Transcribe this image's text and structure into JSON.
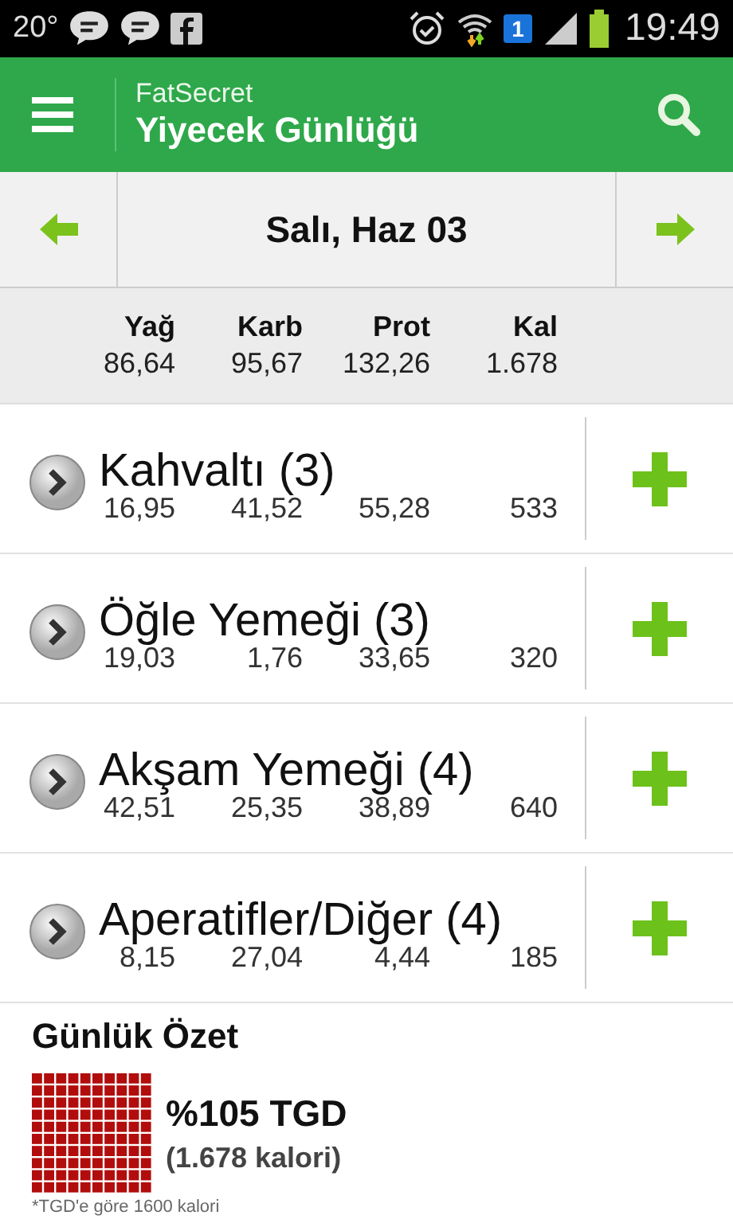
{
  "status_bar": {
    "temperature": "20°",
    "sim_badge": "1",
    "time": "19:49"
  },
  "app_bar": {
    "app_name": "FatSecret",
    "title": "Yiyecek Günlüğü"
  },
  "date_nav": {
    "date": "Salı, Haz 03"
  },
  "totals": {
    "columns": [
      "Yağ",
      "Karb",
      "Prot",
      "Kal"
    ],
    "values": [
      "86,64",
      "95,67",
      "132,26",
      "1.678"
    ]
  },
  "meals": [
    {
      "name": "Kahvaltı (3)",
      "values": [
        "16,95",
        "41,52",
        "55,28",
        "533"
      ]
    },
    {
      "name": "Öğle Yemeği (3)",
      "values": [
        "19,03",
        "1,76",
        "33,65",
        "320"
      ]
    },
    {
      "name": "Akşam Yemeği (4)",
      "values": [
        "42,51",
        "25,35",
        "38,89",
        "640"
      ]
    },
    {
      "name": "Aperatifler/Diğer (4)",
      "values": [
        "8,15",
        "27,04",
        "4,44",
        "185"
      ]
    }
  ],
  "summary": {
    "title": "Günlük Özet",
    "percent": "%105 TGD",
    "calories": "(1.678 kalori)",
    "footnote": "*TGD'e göre 1600 kalori"
  }
}
